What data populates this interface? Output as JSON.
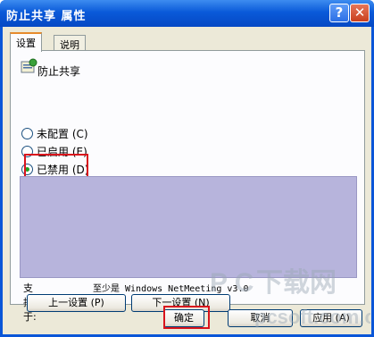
{
  "window": {
    "title": "防止共享 属性",
    "help_glyph": "?",
    "close_glyph": "✕"
  },
  "tabs": [
    {
      "label": "设置"
    },
    {
      "label": "说明"
    }
  ],
  "policy": {
    "name": "防止共享",
    "icon": "policy-setting-icon"
  },
  "options": [
    {
      "label": "未配置 (C)",
      "selected": false
    },
    {
      "label": "已启用 (E)",
      "selected": false
    },
    {
      "label": "已禁用 (D)",
      "selected": true
    }
  ],
  "support": {
    "label": "支持于:",
    "value": "至少是 Windows NetMeeting v3.0"
  },
  "nav": {
    "prev": "上一设置 (P)",
    "next": "下一设置 (N)"
  },
  "buttons": {
    "ok": "确定",
    "cancel": "取消",
    "apply": "应用 (A)"
  },
  "watermark": {
    "brand": "PC下载网",
    "site": "pcsoft.com.cn"
  },
  "colors": {
    "highlight_box": "#d9141c",
    "titlebar": "#0a5ad9",
    "listbox": "#b7b4dc"
  }
}
